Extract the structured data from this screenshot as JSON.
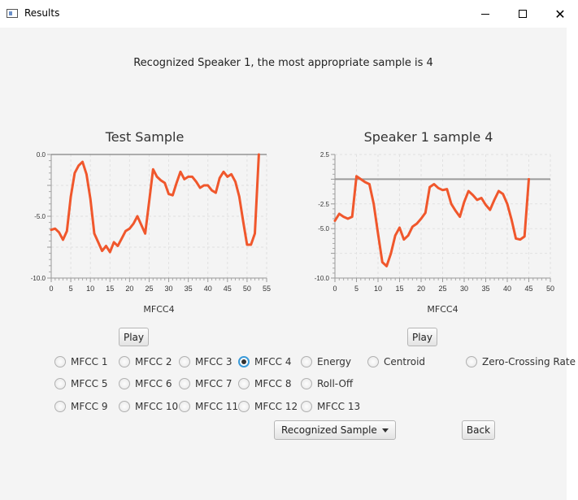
{
  "window": {
    "title": "Results"
  },
  "headline": "Recognized Speaker 1, the most appropriate sample is 4",
  "charts": [
    {
      "title": "Test Sample",
      "play_label": "Play"
    },
    {
      "title": "Speaker 1 sample 4",
      "play_label": "Play"
    }
  ],
  "radios": {
    "row1": [
      "MFCC 1",
      "MFCC 2",
      "MFCC 3",
      "MFCC 4",
      "Energy",
      "Centroid",
      "Zero-Crossing Rate"
    ],
    "row2": [
      "MFCC 5",
      "MFCC 6",
      "MFCC 7",
      "MFCC 8",
      "Roll-Off"
    ],
    "row3": [
      "MFCC 9",
      "MFCC 10",
      "MFCC 11",
      "MFCC 12",
      "MFCC 13"
    ],
    "selected": "MFCC 4"
  },
  "combo": {
    "value": "Recognized Sample"
  },
  "back_label": "Back",
  "colors": {
    "series": "#f0572c",
    "baseline": "#9a9a9a",
    "selected_radio": "#3a9ad9"
  },
  "chart_data": [
    {
      "type": "line",
      "title": "Test Sample",
      "xlabel": "MFCC4",
      "ylabel": "",
      "xlim": [
        0,
        55
      ],
      "ylim": [
        -10,
        0
      ],
      "xticks": [
        "0",
        "5",
        "10",
        "15",
        "20",
        "25",
        "30",
        "35",
        "40",
        "45",
        "50",
        "55"
      ],
      "yticks": [
        "-10.0",
        "-5.0",
        "0.0"
      ],
      "grid": true,
      "x": [
        0,
        1,
        2,
        3,
        4,
        5,
        6,
        7,
        8,
        9,
        10,
        11,
        12,
        13,
        14,
        15,
        16,
        17,
        18,
        19,
        20,
        21,
        22,
        23,
        24,
        25,
        26,
        27,
        28,
        29,
        30,
        31,
        32,
        33,
        34,
        35,
        36,
        37,
        38,
        39,
        40,
        41,
        42,
        43,
        44,
        45,
        46,
        47,
        48,
        49,
        50,
        51,
        52,
        53
      ],
      "series": [
        {
          "values": [
            -6.1,
            -6.0,
            -6.3,
            -6.9,
            -6.2,
            -3.4,
            -1.5,
            -0.9,
            -0.6,
            -1.6,
            -3.6,
            -6.4,
            -7.1,
            -7.8,
            -7.4,
            -7.9,
            -7.1,
            -7.4,
            -6.8,
            -6.2,
            -6.0,
            -5.6,
            -5.0,
            -5.7,
            -6.4,
            -3.8,
            -1.2,
            -1.8,
            -2.1,
            -2.3,
            -3.2,
            -3.3,
            -2.3,
            -1.4,
            -2.0,
            -1.8,
            -1.8,
            -2.2,
            -2.7,
            -2.5,
            -2.5,
            -2.9,
            -3.1,
            -1.9,
            -1.4,
            -1.8,
            -1.6,
            -2.2,
            -3.4,
            -5.4,
            -7.3,
            -7.3,
            -6.4,
            0.0
          ]
        }
      ]
    },
    {
      "type": "line",
      "title": "Speaker 1 sample 4",
      "xlabel": "MFCC4",
      "ylabel": "",
      "xlim": [
        0,
        50
      ],
      "ylim": [
        -10,
        2.5
      ],
      "xticks": [
        "0",
        "5",
        "10",
        "15",
        "20",
        "25",
        "30",
        "35",
        "40",
        "45",
        "50"
      ],
      "yticks": [
        "-10.0",
        "-5.0",
        "-2.5",
        "2.5"
      ],
      "grid": true,
      "baseline_y": 0,
      "x": [
        0,
        1,
        2,
        3,
        4,
        5,
        6,
        7,
        8,
        9,
        10,
        11,
        12,
        13,
        14,
        15,
        16,
        17,
        18,
        19,
        20,
        21,
        22,
        23,
        24,
        25,
        26,
        27,
        28,
        29,
        30,
        31,
        32,
        33,
        34,
        35,
        36,
        37,
        38,
        39,
        40,
        41,
        42,
        43,
        44,
        45
      ],
      "series": [
        {
          "values": [
            -4.2,
            -3.5,
            -3.8,
            -4.0,
            -3.8,
            0.3,
            0.0,
            -0.3,
            -0.5,
            -2.5,
            -5.5,
            -8.4,
            -8.8,
            -7.5,
            -5.7,
            -4.9,
            -6.1,
            -5.7,
            -4.8,
            -4.5,
            -4.0,
            -3.4,
            -0.8,
            -0.5,
            -0.9,
            -1.1,
            -1.0,
            -2.5,
            -3.2,
            -3.8,
            -2.3,
            -1.2,
            -1.6,
            -2.1,
            -1.9,
            -2.6,
            -3.1,
            -2.1,
            -1.2,
            -1.5,
            -2.5,
            -4.1,
            -6.0,
            -6.1,
            -5.8,
            0.0
          ]
        }
      ]
    }
  ]
}
